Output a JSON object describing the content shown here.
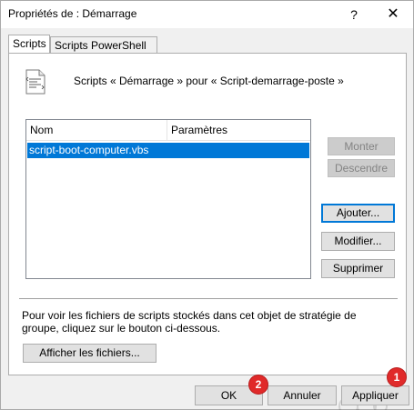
{
  "window": {
    "title": "Propriétés de : Démarrage",
    "help_glyph": "?",
    "close_glyph": "✕"
  },
  "tabs": [
    {
      "label": "Scripts",
      "active": true
    },
    {
      "label": "Scripts PowerShell",
      "active": false
    }
  ],
  "panel": {
    "heading": "Scripts « Démarrage » pour « Script-demarrage-poste »",
    "icon": "script-document-icon",
    "list": {
      "columns": [
        "Nom",
        "Paramètres"
      ],
      "rows": [
        {
          "nom": "script-boot-computer.vbs",
          "params": "",
          "selected": true
        }
      ]
    },
    "buttons": {
      "monter": "Monter",
      "descendre": "Descendre",
      "ajouter": "Ajouter...",
      "modifier": "Modifier...",
      "supprimer": "Supprimer"
    },
    "info": "Pour voir les fichiers de scripts stockés dans cet objet de stratégie de groupe, cliquez sur le bouton ci-dessous.",
    "show_files": "Afficher les fichiers..."
  },
  "footer": {
    "ok": "OK",
    "annuler": "Annuler",
    "appliquer": "Appliquer"
  },
  "annotations": {
    "badge_1": "1",
    "badge_2": "2",
    "color": "#e02a2a"
  },
  "colors": {
    "selection": "#0078d7",
    "default_button_border": "#0078d7"
  }
}
